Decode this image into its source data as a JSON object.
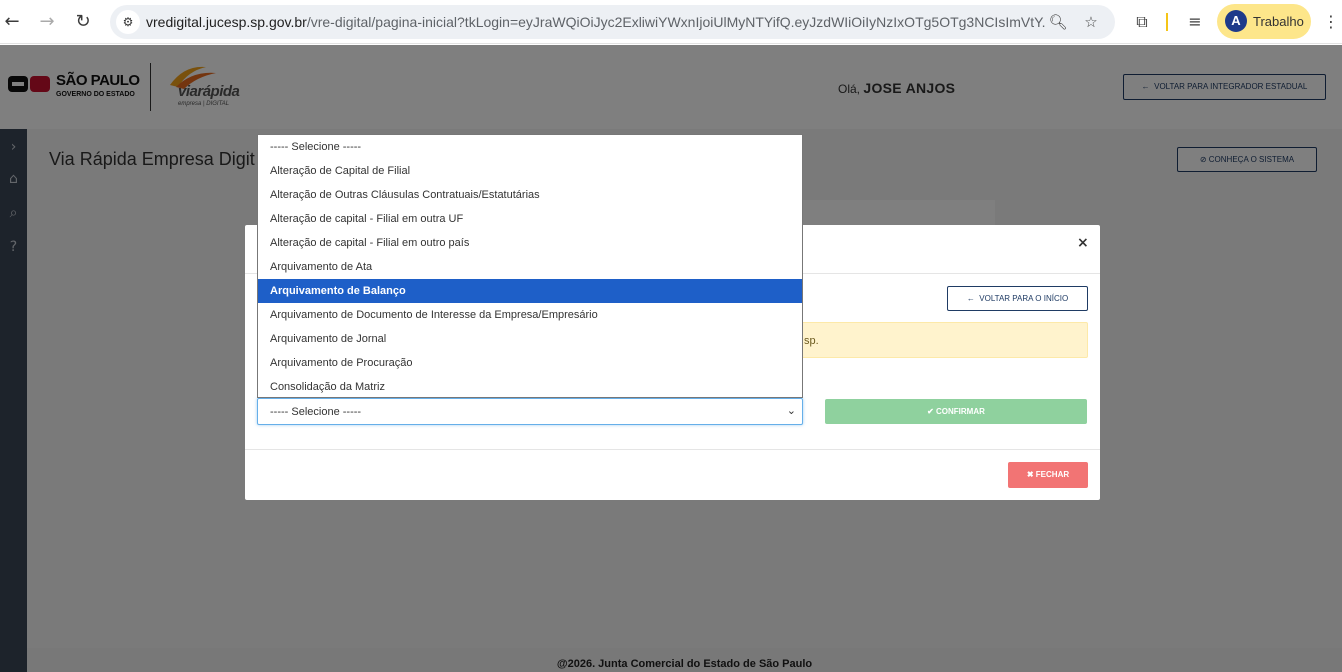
{
  "browser": {
    "url_host": "vredigital.jucesp.sp.gov.br",
    "url_path": "/vre-digital/pagina-inicial?tkLogin=eyJraWQiOiJyc2ExliwiYWxnIjoiUlMyNTYifQ.eyJzdWIiOiIyNzIxOTg5OTg3NCIsImVtY...",
    "profile_initial": "A",
    "profile_name": "Trabalho",
    "icons": [
      "back-icon",
      "forward-icon",
      "reload-icon",
      "site-info-icon",
      "zoom-icon",
      "star-icon",
      "extensions-icon",
      "media-icon",
      "menu-icon"
    ]
  },
  "header": {
    "gov_name": "SÃO PAULO",
    "gov_sub": "GOVERNO DO ESTADO",
    "brand": "viarápida",
    "brand_sub": "empresa | DIGITAL",
    "greeting": "Olá,",
    "user_name": "JOSE ANJOS",
    "back_integrator": "VOLTAR PARA INTEGRADOR ESTADUAL"
  },
  "page": {
    "title": "Via Rápida Empresa Digit",
    "know_system": "CONHEÇA O SISTEMA",
    "footer": "@2026. Junta Comercial do Estado de São Paulo"
  },
  "modal": {
    "back_home": "VOLTAR PARA O INÍCIO",
    "alert_text_visible": "sp.",
    "select_value": "----- Selecione -----",
    "confirm_label": "CONFIRMAR",
    "close_label": "FECHAR",
    "close_x": "×"
  },
  "dropdown": {
    "selected_index": 6,
    "options": [
      "----- Selecione -----",
      "Alteração de Capital de Filial",
      "Alteração de Outras Cláusulas Contratuais/Estatutárias",
      "Alteração de capital - Filial em outra UF",
      "Alteração de capital - Filial em outro país",
      "Arquivamento de Ata",
      "Arquivamento de Balanço",
      "Arquivamento de Documento de Interesse da Empresa/Empresário",
      "Arquivamento de Jornal",
      "Arquivamento de Procuração",
      "Consolidação da Matriz"
    ]
  }
}
